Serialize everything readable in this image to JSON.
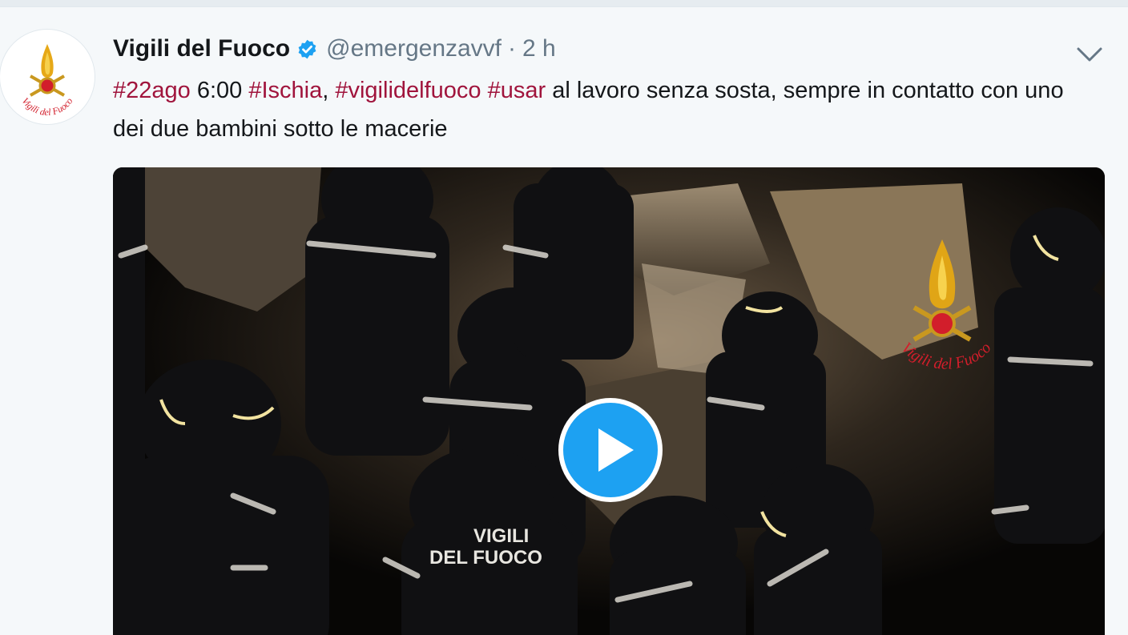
{
  "tweet": {
    "author_name": "Vigili del Fuoco",
    "handle": "@emergenzavvf",
    "separator": "·",
    "time": "2 h",
    "text_parts": {
      "h1": "#22ago",
      "t1": " 6:00 ",
      "h2": "#Ischia",
      "t2": ", ",
      "h3": "#vigilidelfuoco",
      "t3": " ",
      "h4": "#usar",
      "t4": " al lavoro senza sosta, sempre in contatto con uno dei due bambini sotto le macerie"
    },
    "video": {
      "vest_text_line1": "VIGILI",
      "vest_text_line2": "DEL FUOCO",
      "watermark_text": "Vigili del Fuoco"
    },
    "avatar_logo_text": "Vigili del Fuoco"
  },
  "colors": {
    "hashtag": "#a0143c",
    "verified": "#1da1f2",
    "play_button": "#1da1f2",
    "muted_text": "#657786"
  },
  "icons": [
    "verified-badge-icon",
    "chevron-down-icon",
    "play-icon",
    "fire-flame-logo-icon"
  ]
}
